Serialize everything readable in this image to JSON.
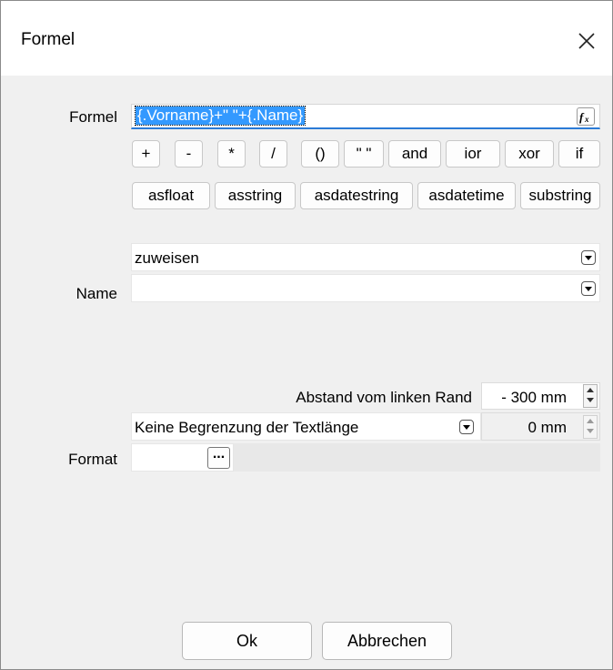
{
  "window": {
    "title": "Formel"
  },
  "formula": {
    "label": "Formel",
    "value": "{.Vorname}+\" \"+{.Name}",
    "fx_icon": "function-fx-icon",
    "ops_row1": [
      "+",
      "-",
      "*",
      "/",
      "()",
      "\" \"",
      "and",
      "ior",
      "xor",
      "if"
    ],
    "ops_row2": [
      "asfloat",
      "asstring",
      "asdatestring",
      "asdatetime",
      "substring"
    ]
  },
  "assign": {
    "value": "zuweisen"
  },
  "name": {
    "label": "Name",
    "value": ""
  },
  "position": {
    "label": "Abstand vom linken Rand",
    "value": "- 300 mm"
  },
  "length": {
    "option": "Keine Begrenzung der Textlänge",
    "value": "0 mm"
  },
  "format": {
    "label": "Format",
    "browse": "..."
  },
  "footer": {
    "ok": "Ok",
    "cancel": "Abbrechen"
  }
}
